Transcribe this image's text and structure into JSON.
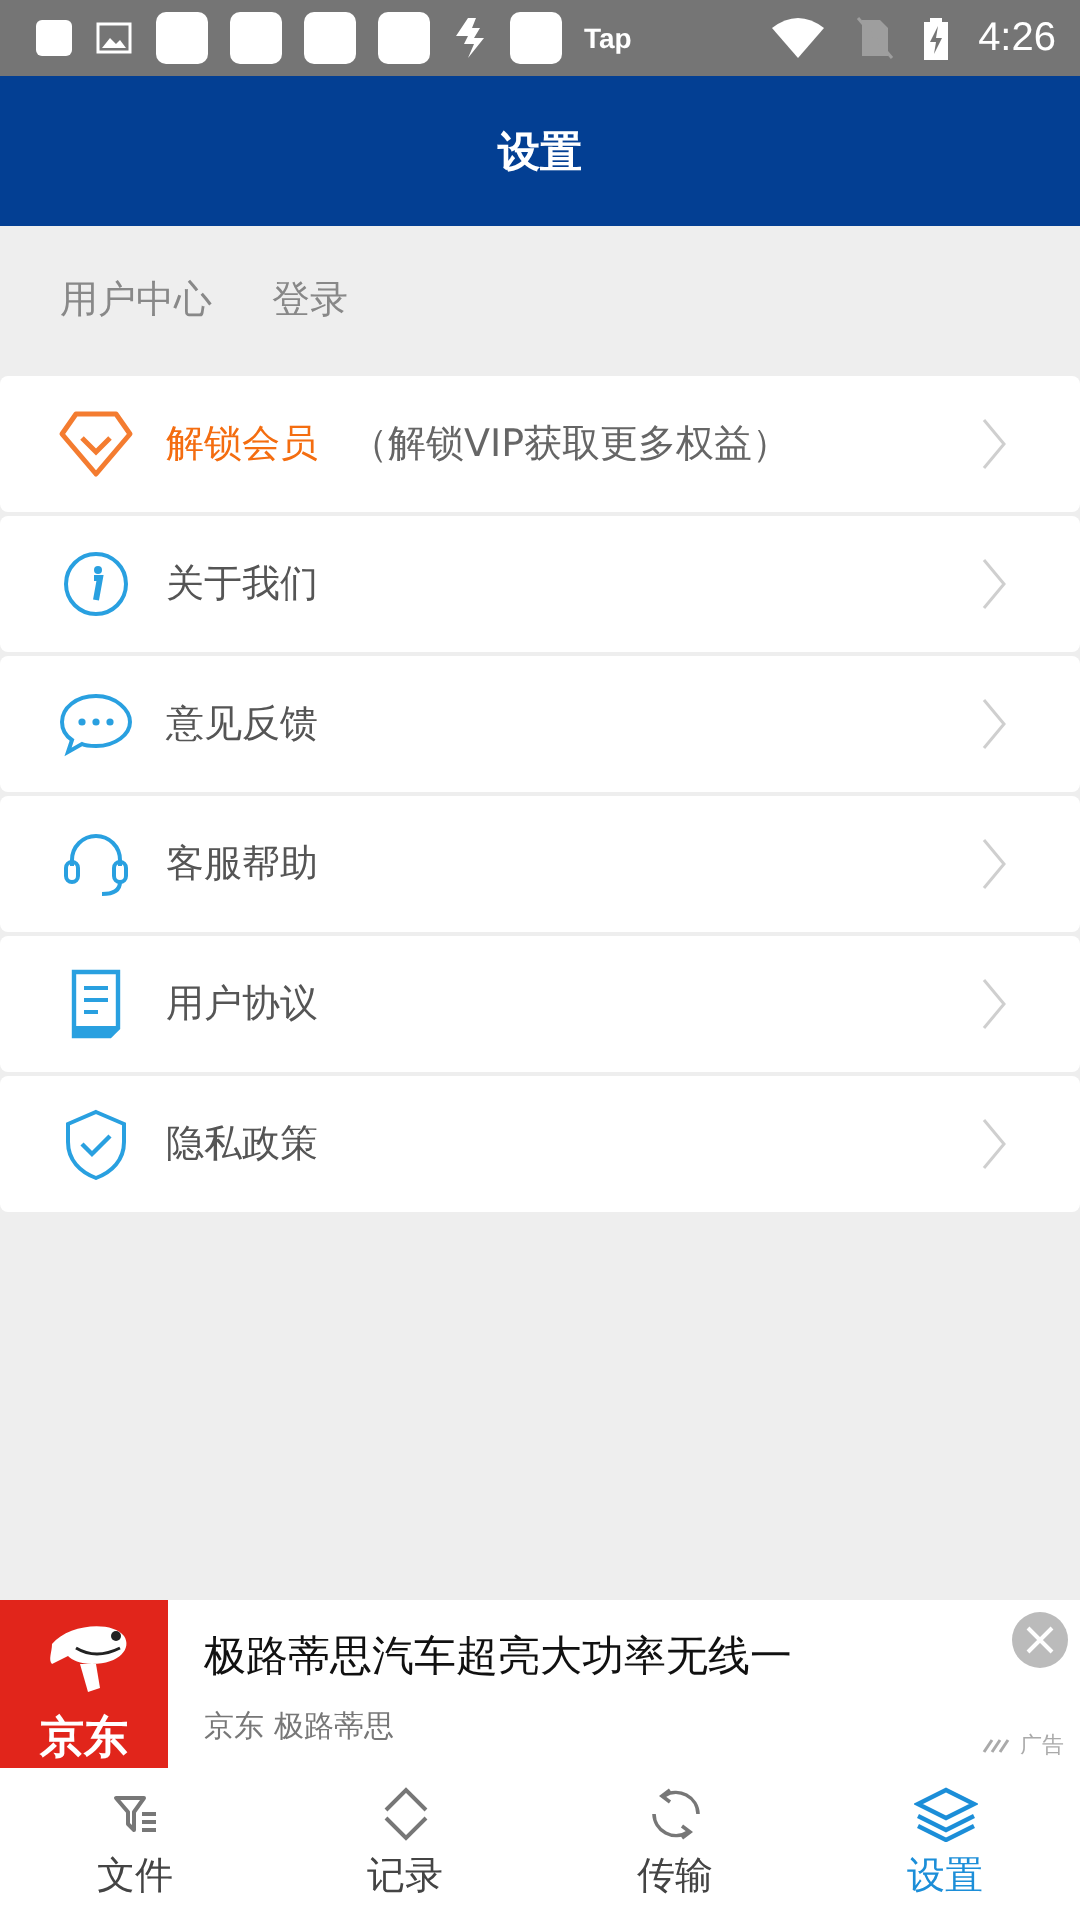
{
  "status_bar": {
    "app_label": "Tap",
    "time": "4:26"
  },
  "header": {
    "title": "设置"
  },
  "user": {
    "name": "用户中心",
    "login": "登录"
  },
  "menu": [
    {
      "label": "解锁会员",
      "note": "（解锁VIP获取更多权益）",
      "accent": true
    },
    {
      "label": "关于我们",
      "accent": false
    },
    {
      "label": "意见反馈",
      "accent": false
    },
    {
      "label": "客服帮助",
      "accent": false
    },
    {
      "label": "用户协议",
      "accent": false
    },
    {
      "label": "隐私政策",
      "accent": false
    }
  ],
  "ad": {
    "logo_text": "京东",
    "title": "极路蒂思汽车超亮大功率无线一",
    "source": "京东 极路蒂思",
    "ad_label": "广告"
  },
  "tabs": [
    {
      "label": "文件",
      "selected": false
    },
    {
      "label": "记录",
      "selected": false
    },
    {
      "label": "传输",
      "selected": false
    },
    {
      "label": "设置",
      "selected": true
    }
  ]
}
